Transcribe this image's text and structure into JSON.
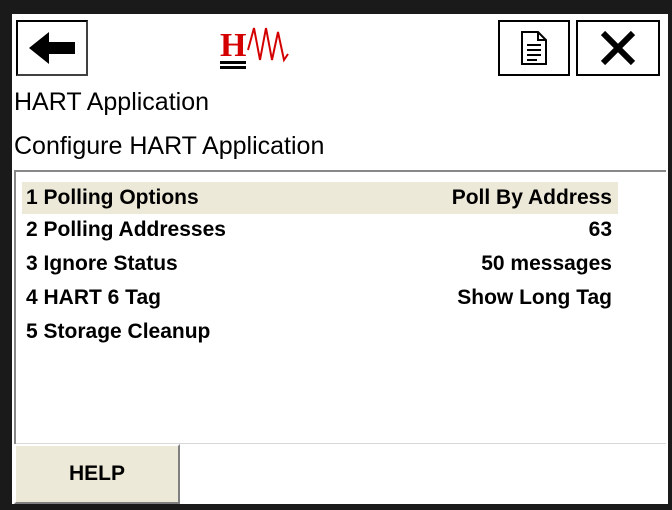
{
  "header": {
    "back_icon": "arrow-left-icon",
    "logo_text": "H",
    "doc_icon": "document-icon",
    "close_icon": "close-icon"
  },
  "titles": {
    "app": "HART Application",
    "page": "Configure HART Application"
  },
  "menu": {
    "items": [
      {
        "label": "1 Polling Options",
        "value": "Poll By Address",
        "selected": true
      },
      {
        "label": "2 Polling Addresses",
        "value": "63",
        "selected": false
      },
      {
        "label": "3 Ignore Status",
        "value": "50 messages",
        "selected": false
      },
      {
        "label": "4 HART 6 Tag",
        "value": "Show Long Tag",
        "selected": false
      },
      {
        "label": "5 Storage Cleanup",
        "value": "",
        "selected": false
      }
    ]
  },
  "footer": {
    "help_label": "HELP"
  },
  "colors": {
    "selection": "#ece9d8",
    "logo_red": "#d40000"
  }
}
